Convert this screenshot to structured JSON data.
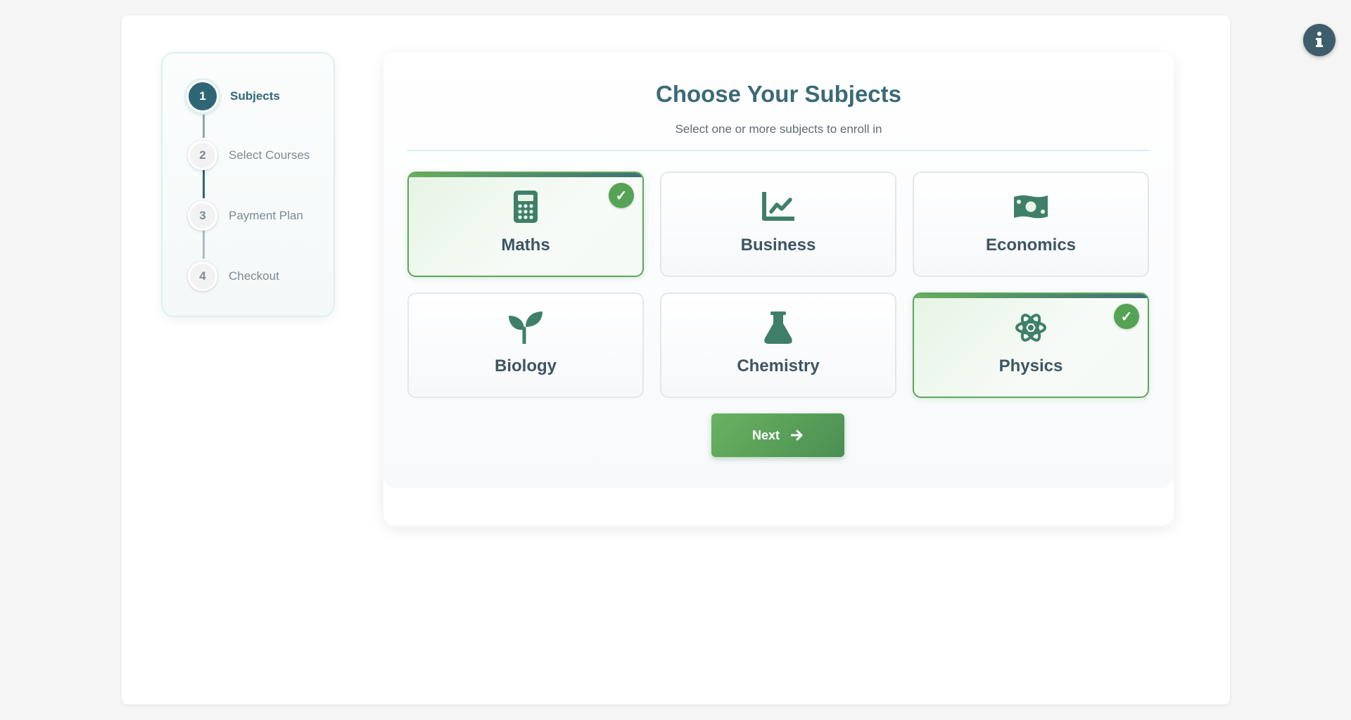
{
  "stepper": {
    "steps": [
      {
        "number": "1",
        "label": "Subjects",
        "active": true
      },
      {
        "number": "2",
        "label": "Select Courses",
        "active": false
      },
      {
        "number": "3",
        "label": "Payment Plan",
        "active": false
      },
      {
        "number": "4",
        "label": "Checkout",
        "active": false
      }
    ]
  },
  "main": {
    "title": "Choose Your Subjects",
    "subtitle": "Select one or more subjects to enroll in",
    "subjects": [
      {
        "label": "Maths",
        "icon": "calculator-icon",
        "selected": true
      },
      {
        "label": "Business",
        "icon": "chart-line-icon",
        "selected": false
      },
      {
        "label": "Economics",
        "icon": "money-bill-icon",
        "selected": false
      },
      {
        "label": "Biology",
        "icon": "seedling-icon",
        "selected": false
      },
      {
        "label": "Chemistry",
        "icon": "flask-icon",
        "selected": false
      },
      {
        "label": "Physics",
        "icon": "atom-icon",
        "selected": true
      }
    ],
    "check_mark": "✓",
    "next_label": "Next"
  },
  "info_button": {
    "icon": "info-icon"
  },
  "colors": {
    "primary": "#2e6675",
    "accent_green": "#56a356",
    "icon_green": "#3f7f6a"
  }
}
